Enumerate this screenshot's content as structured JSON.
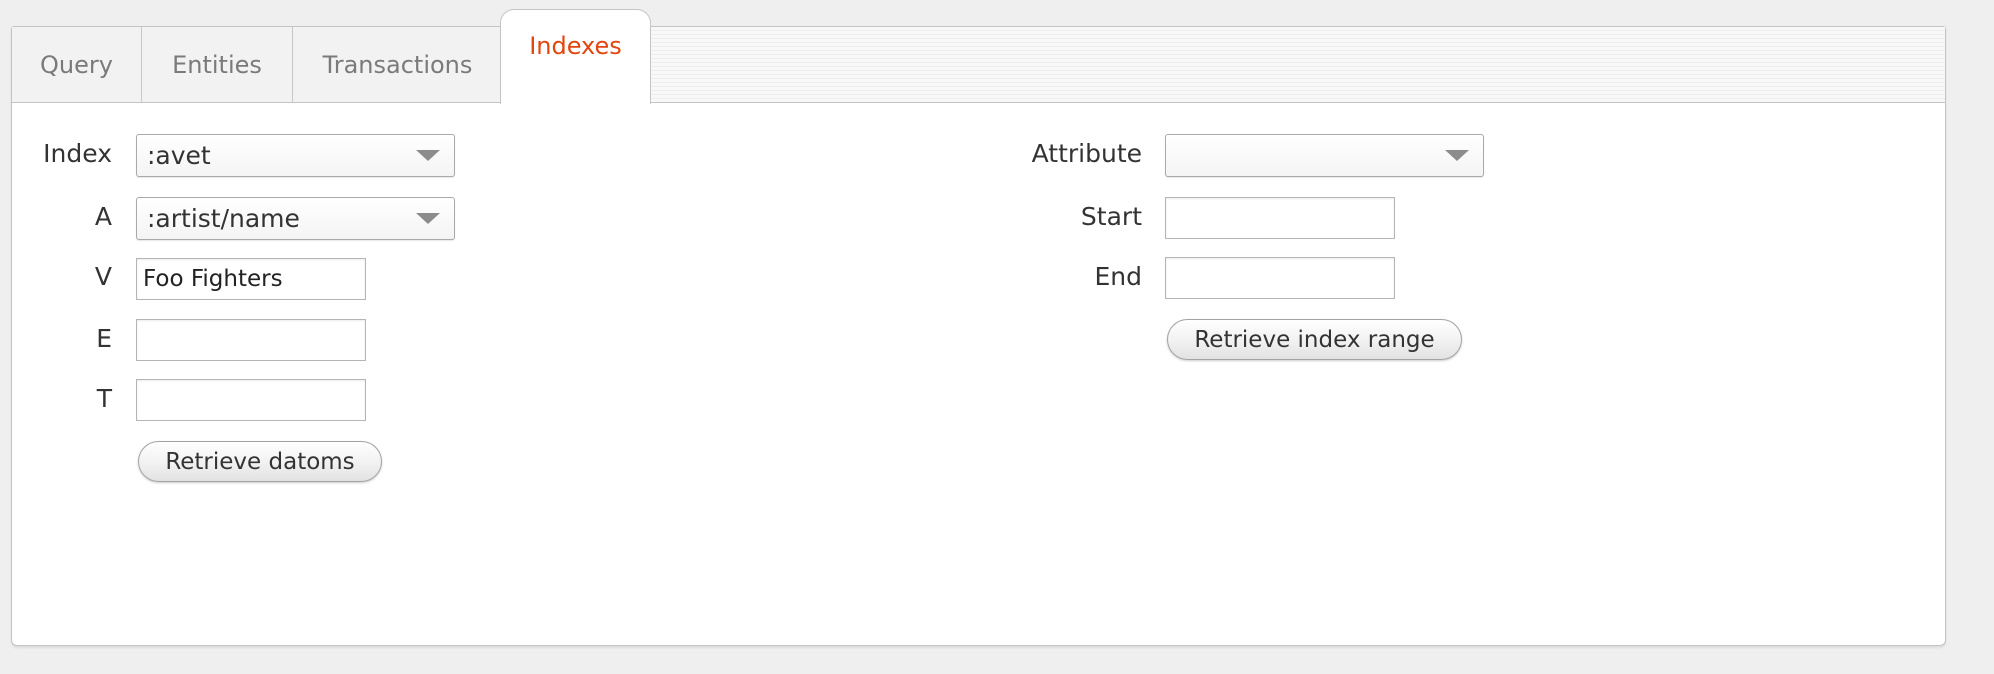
{
  "tabs": [
    {
      "label": "Query"
    },
    {
      "label": "Entities"
    },
    {
      "label": "Transactions"
    },
    {
      "label": "Indexes",
      "active": true
    }
  ],
  "colors": {
    "active_tab_text": "#e2450d",
    "inactive_tab_text": "#7a7a7a",
    "label_text": "#333333",
    "panel_background": "#ffffff",
    "page_background": "#efefef"
  },
  "left_form": {
    "index": {
      "label": "Index",
      "value": ":avet"
    },
    "a": {
      "label": "A",
      "value": ":artist/name"
    },
    "v": {
      "label": "V",
      "value": "Foo Fighters"
    },
    "e": {
      "label": "E",
      "value": ""
    },
    "t": {
      "label": "T",
      "value": ""
    },
    "retrieve_button": "Retrieve datoms"
  },
  "right_form": {
    "attribute": {
      "label": "Attribute",
      "value": ""
    },
    "start": {
      "label": "Start",
      "value": ""
    },
    "end": {
      "label": "End",
      "value": ""
    },
    "retrieve_button": "Retrieve index range"
  },
  "icons": {
    "dropdown": "chevron-down-icon"
  }
}
